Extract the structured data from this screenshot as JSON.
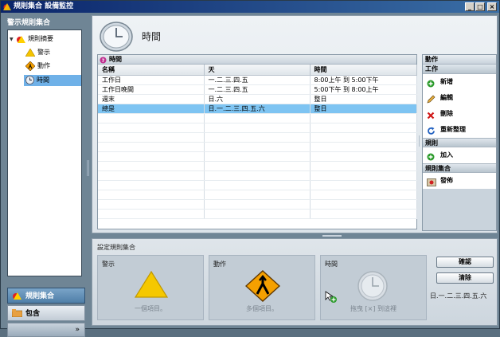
{
  "window": {
    "title": "規則集合 設備監控",
    "controls": {
      "minimize": "_",
      "maximize": "□",
      "close": "×"
    }
  },
  "left_panel": {
    "header": "警示規則集合",
    "tree": {
      "root": "規則摘要",
      "items": [
        {
          "label": "警示",
          "icon": "warning-triangle-icon"
        },
        {
          "label": "動作",
          "icon": "action-diamond-icon"
        },
        {
          "label": "時間",
          "icon": "clock-icon"
        }
      ]
    },
    "nav": {
      "rule_sets": "規則集合",
      "include": "包含",
      "more": "»"
    }
  },
  "main": {
    "title": "時間",
    "grid": {
      "title": "時間",
      "columns": [
        "名稱",
        "天",
        "時間"
      ],
      "rows": [
        [
          "工作日",
          "一.二.三.四.五",
          "8:00上午 到 5:00下午"
        ],
        [
          "工作日晚間",
          "一.二.三.四.五",
          "5:00下午 到 8:00上午"
        ],
        [
          "週末",
          "日.六",
          "整日"
        ],
        [
          "總是",
          "日.一.二.三.四.五.六",
          "整日"
        ]
      ],
      "selected_row": 3
    }
  },
  "actions": {
    "header": "動作",
    "sections": [
      {
        "title": "工作",
        "items": [
          {
            "label": "新增",
            "icon": "add-icon"
          },
          {
            "label": "編輯",
            "icon": "edit-pencil-icon"
          },
          {
            "label": "刪除",
            "icon": "delete-x-icon"
          },
          {
            "label": "重新整理",
            "icon": "refresh-icon"
          }
        ]
      },
      {
        "title": "規則",
        "items": [
          {
            "label": "加入",
            "icon": "add-icon"
          }
        ]
      },
      {
        "title": "規則集合",
        "items": [
          {
            "label": "發佈",
            "icon": "publish-icon"
          }
        ]
      }
    ]
  },
  "bottom": {
    "title": "設定規則集合",
    "slots": [
      {
        "label": "警示",
        "text": "一個項目。"
      },
      {
        "label": "動作",
        "text": "多個項目。"
      },
      {
        "label": "時間",
        "text": "拖曳 [×] 到這裡"
      }
    ],
    "confirm": "確認",
    "clear": "清除",
    "days": "日.一.二.三.四.五.六"
  },
  "colors": {
    "selection": "#7ec4f2",
    "title_bar": "#0a246a",
    "warning": "#f5c400"
  }
}
